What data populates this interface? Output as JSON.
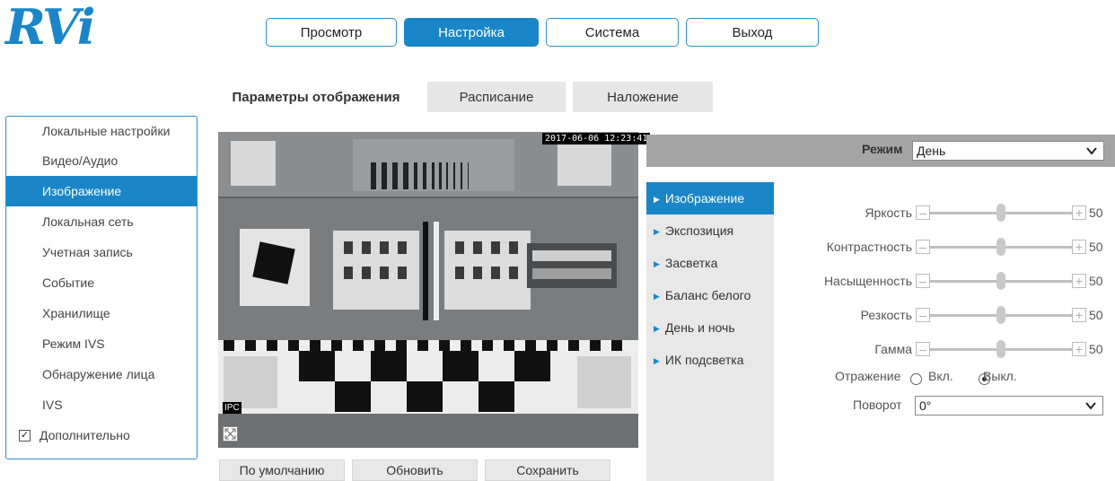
{
  "logo": {
    "text": "RVi"
  },
  "nav": {
    "items": [
      {
        "label": "Просмотр"
      },
      {
        "label": "Настройка"
      },
      {
        "label": "Система"
      },
      {
        "label": "Выход"
      }
    ],
    "active": "Настройка"
  },
  "sidebar": {
    "items": [
      {
        "label": "Локальные настройки"
      },
      {
        "label": "Видео/Аудио"
      },
      {
        "label": "Изображение"
      },
      {
        "label": "Локальная сеть"
      },
      {
        "label": "Учетная запись"
      },
      {
        "label": "Событие"
      },
      {
        "label": "Хранилище"
      },
      {
        "label": "Режим IVS"
      },
      {
        "label": "Обнаружение лица"
      },
      {
        "label": "IVS"
      },
      {
        "label": "Дополнительно",
        "checked": true
      }
    ],
    "active": "Изображение"
  },
  "tabs": [
    {
      "label": "Параметры отображения"
    },
    {
      "label": "Расписание"
    },
    {
      "label": "Наложение"
    }
  ],
  "video": {
    "timestamp": "2017-06-06 12:23:41",
    "channel_label": "IPC"
  },
  "buttons": {
    "default": "По умолчанию",
    "refresh": "Обновить",
    "save": "Сохранить"
  },
  "mode": {
    "label": "Режим",
    "value": "День"
  },
  "submenu": [
    {
      "label": "Изображение"
    },
    {
      "label": "Экспозиция"
    },
    {
      "label": "Засветка"
    },
    {
      "label": "Баланс белого"
    },
    {
      "label": "День и ночь"
    },
    {
      "label": "ИК подсветка"
    }
  ],
  "sliders": [
    {
      "label": "Яркость",
      "value": "50"
    },
    {
      "label": "Контрастность",
      "value": "50"
    },
    {
      "label": "Насыщенность",
      "value": "50"
    },
    {
      "label": "Резкость",
      "value": "50"
    },
    {
      "label": "Гамма",
      "value": "50"
    }
  ],
  "mirror": {
    "label": "Отражение",
    "on_label": "Вкл.",
    "off_label": "Выкл.",
    "selected": "off"
  },
  "rotation": {
    "label": "Поворот",
    "value": "0°"
  },
  "colors": {
    "accent": "#1a86c8",
    "mode_bar": "#a5a5a5",
    "submenu_bg": "#e8e8e8"
  }
}
